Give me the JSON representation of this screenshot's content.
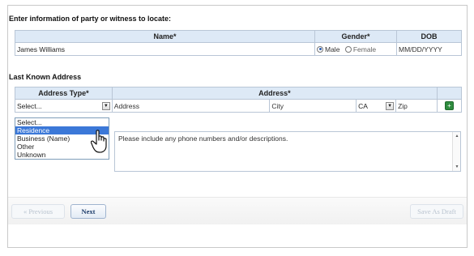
{
  "section": {
    "title": "Enter information of party or witness to locate:",
    "last_known_address": "Last Known Address"
  },
  "party_table": {
    "headers": {
      "name": "Name*",
      "gender": "Gender*",
      "dob": "DOB"
    },
    "name_value": "James Williams",
    "gender_options": [
      {
        "label": "Male",
        "selected": true
      },
      {
        "label": "Female",
        "selected": false
      }
    ],
    "dob_placeholder": "MM/DD/YYYY"
  },
  "address_table": {
    "headers": {
      "address_type": "Address Type*",
      "address": "Address*"
    },
    "address_type_value": "Select...",
    "address_placeholder": "Address",
    "city_placeholder": "City",
    "state_value": "CA",
    "zip_placeholder": "Zip"
  },
  "address_type_dropdown": {
    "options": [
      "Select...",
      "Residence",
      "Business (Name)",
      "Other",
      "Unknown"
    ],
    "highlighted_index": 1
  },
  "description": {
    "placeholder": "Please include any phone numbers and/or descriptions."
  },
  "buttons": {
    "previous": "« Previous",
    "next": "Next",
    "save_draft": "Save As Draft"
  },
  "icons": {
    "add_row": "plus-icon",
    "cursor": "hand-pointer-icon"
  },
  "colors": {
    "header_bg": "#dde9f6",
    "highlight": "#3b78d8",
    "add_button": "#2e8b3e"
  }
}
